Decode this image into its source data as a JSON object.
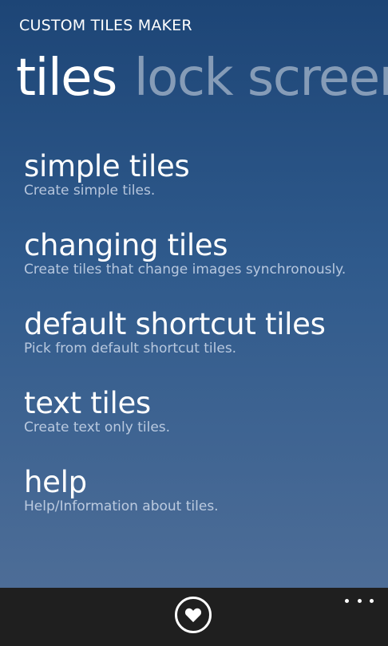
{
  "app": {
    "title": "CUSTOM TILES MAKER"
  },
  "pivot": {
    "tabs": [
      {
        "label": "tiles",
        "active": true
      },
      {
        "label": "lock screen",
        "active": false
      }
    ]
  },
  "menu": {
    "items": [
      {
        "title": "simple tiles",
        "subtitle": "Create simple tiles."
      },
      {
        "title": "changing tiles",
        "subtitle": "Create tiles that change images synchronously."
      },
      {
        "title": "default shortcut tiles",
        "subtitle": "Pick from default shortcut tiles."
      },
      {
        "title": "text tiles",
        "subtitle": "Create text only tiles."
      },
      {
        "title": "help",
        "subtitle": "Help/Information about tiles."
      }
    ]
  },
  "app_bar": {
    "buttons": [
      {
        "icon": "heart-icon"
      }
    ],
    "more_icon": "ellipsis-icon"
  },
  "colors": {
    "background_top": "#1d4576",
    "background_bottom": "#4d6d97",
    "app_bar": "#1f1f1f",
    "text": "#ffffff"
  }
}
